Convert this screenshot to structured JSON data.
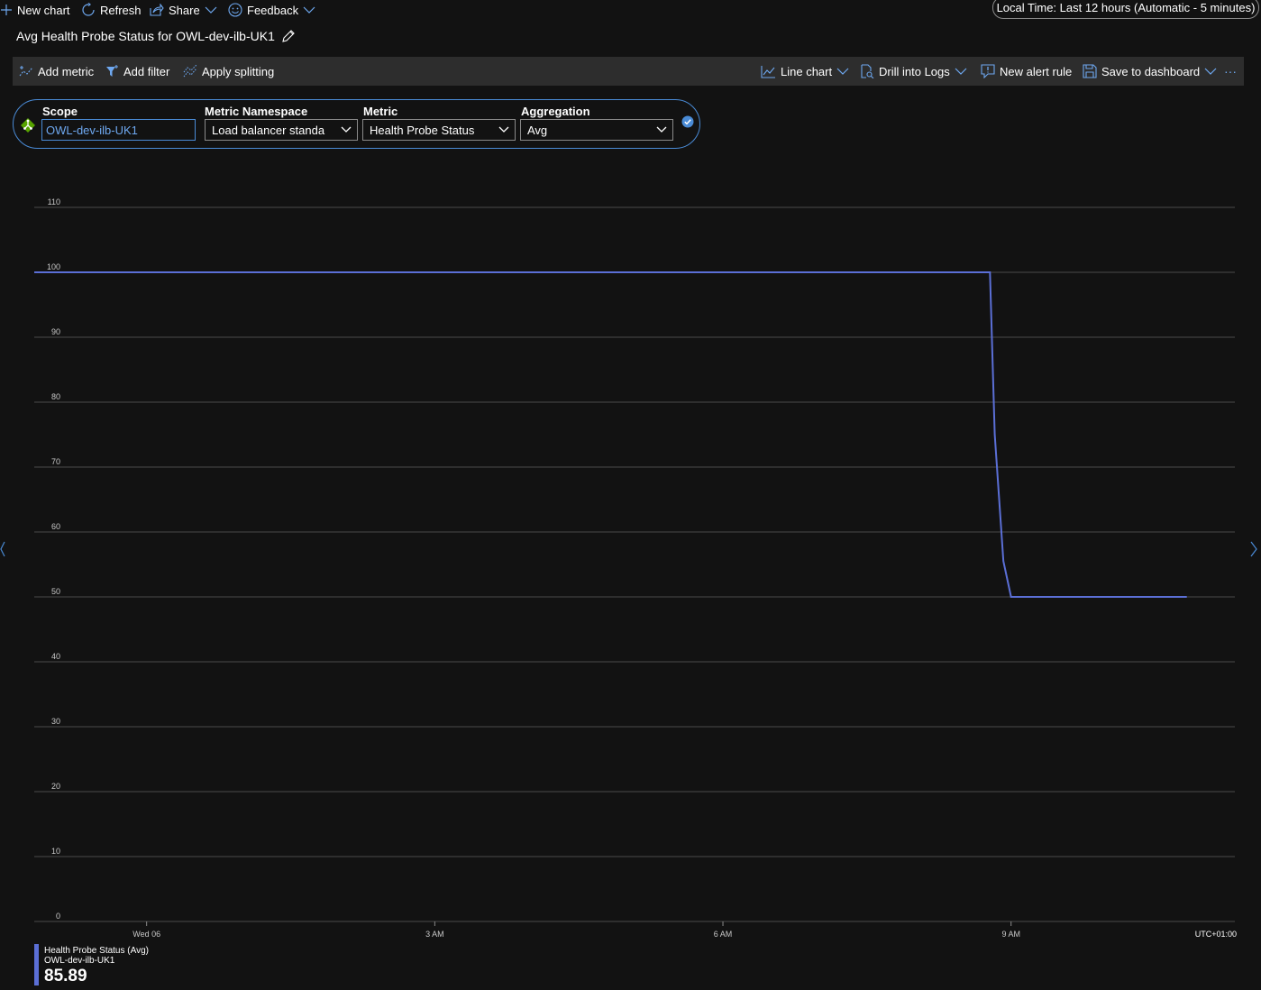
{
  "topbar": {
    "new_chart": "New chart",
    "refresh": "Refresh",
    "share": "Share",
    "feedback": "Feedback",
    "time_range": "Local Time: Last 12 hours (Automatic - 5 minutes)"
  },
  "title": "Avg Health Probe Status for OWL-dev-ilb-UK1",
  "toolbar": {
    "add_metric": "Add metric",
    "add_filter": "Add filter",
    "apply_splitting": "Apply splitting",
    "line_chart": "Line chart",
    "drill_logs": "Drill into Logs",
    "new_alert": "New alert rule",
    "save_dashboard": "Save to dashboard",
    "more": "···"
  },
  "metric_row": {
    "scope_label": "Scope",
    "scope_value": "OWL-dev-ilb-UK1",
    "namespace_label": "Metric Namespace",
    "namespace_value": "Load balancer standa",
    "metric_label": "Metric",
    "metric_value": "Health Probe Status",
    "aggregation_label": "Aggregation",
    "aggregation_value": "Avg"
  },
  "colors": {
    "accent": "#4a8bd6",
    "series": "#5b6fd6",
    "background": "#121212",
    "toolbar": "#2d2d2d"
  },
  "chart_data": {
    "type": "line",
    "ylim": [
      0,
      110
    ],
    "yticks": [
      "0",
      "10",
      "20",
      "30",
      "40",
      "50",
      "60",
      "70",
      "80",
      "90",
      "100",
      "110"
    ],
    "xticks": [
      {
        "label": "Wed 06",
        "hours": 0
      },
      {
        "label": "3 AM",
        "hours": 3
      },
      {
        "label": "6 AM",
        "hours": 6
      },
      {
        "label": "9 AM",
        "hours": 9
      }
    ],
    "xlim_hours": [
      -1.17,
      11.33
    ],
    "timezone": "UTC+01:00",
    "series": [
      {
        "name": "Health Probe Status (Avg)",
        "resource": "OWL-dev-ilb-UK1",
        "summary": "85.89",
        "points": [
          [
            -1.17,
            100
          ],
          [
            8.78,
            100
          ],
          [
            8.83,
            75
          ],
          [
            8.92,
            55.5
          ],
          [
            9.0,
            50
          ],
          [
            10.83,
            50
          ]
        ]
      }
    ]
  }
}
